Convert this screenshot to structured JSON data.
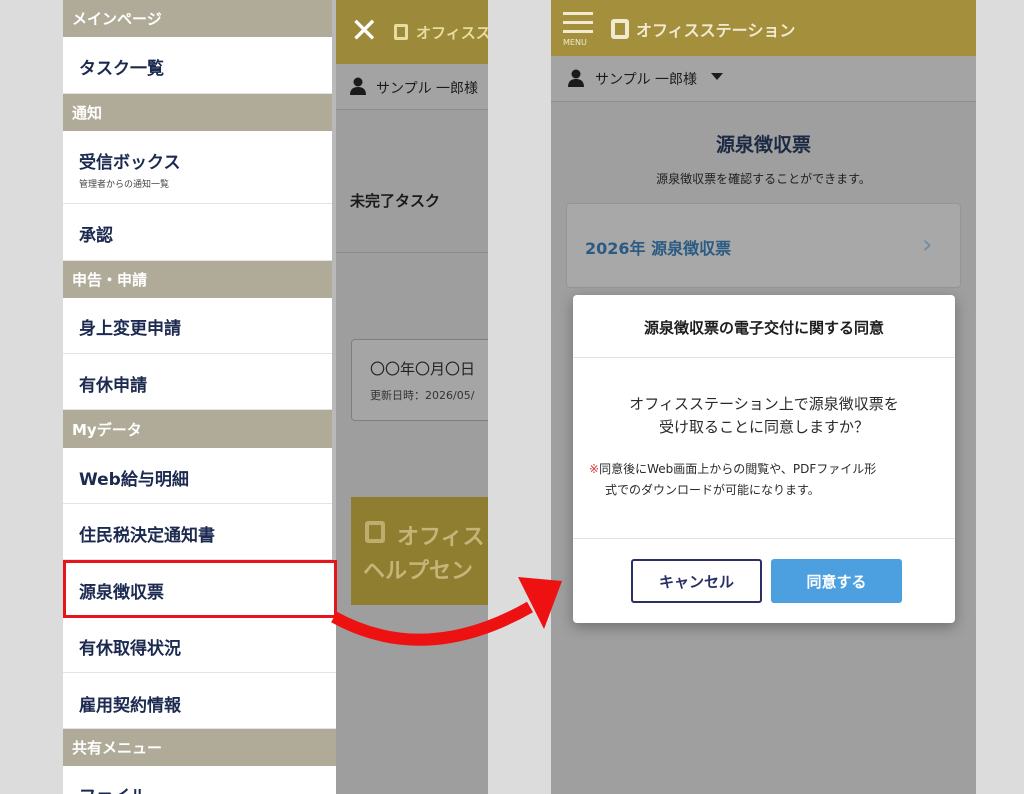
{
  "left": {
    "sections": {
      "main": "メインページ",
      "notice": "通知",
      "apply": "申告・申請",
      "mydata": "Myデータ",
      "shared": "共有メニュー"
    },
    "items": {
      "tasks": "タスク一覧",
      "inbox": "受信ボックス",
      "inbox_sub": "管理者からの通知一覧",
      "approval": "承認",
      "personal_change": "身上変更申請",
      "leave_request": "有休申請",
      "payslip": "Web給与明細",
      "resident_tax": "住民税決定通知書",
      "withholding": "源泉徴収票",
      "leave_status": "有休取得状況",
      "contract": "雇用契約情報",
      "file": "ファイル"
    },
    "background": {
      "brand": "オフィスス",
      "user": "サンプル 一郎様",
      "incomplete_task": "未完了タスク",
      "card_date": "〇〇年〇月〇日",
      "card_updated": "更新日時：2026/05/",
      "help_line1": "オフィス",
      "help_line2": "ヘルプセン"
    }
  },
  "right": {
    "header": {
      "menu_label": "MENU",
      "brand": "オフィスステーション"
    },
    "user": "サンプル 一郎様",
    "page_title": "源泉徴収票",
    "page_desc": "源泉徴収票を確認することができます。",
    "card_label": "2026年 源泉徴収票",
    "dialog": {
      "title": "源泉徴収票の電子交付に関する同意",
      "question_line1": "オフィスステーション上で源泉徴収票を",
      "question_line2": "受け取ることに同意しますか？",
      "note_mark": "※",
      "note_line1": "同意後にWeb画面上からの閲覧や、PDFファイル形",
      "note_line2": "式でのダウンロードが可能になります。",
      "cancel_label": "キャンセル",
      "agree_label": "同意する"
    }
  },
  "colors": {
    "header_gold": "#c9b052",
    "section_gray": "#b0ab98",
    "highlight_red": "#e8141c",
    "agree_blue": "#4da0e0",
    "nav_text": "#1c2a50"
  }
}
